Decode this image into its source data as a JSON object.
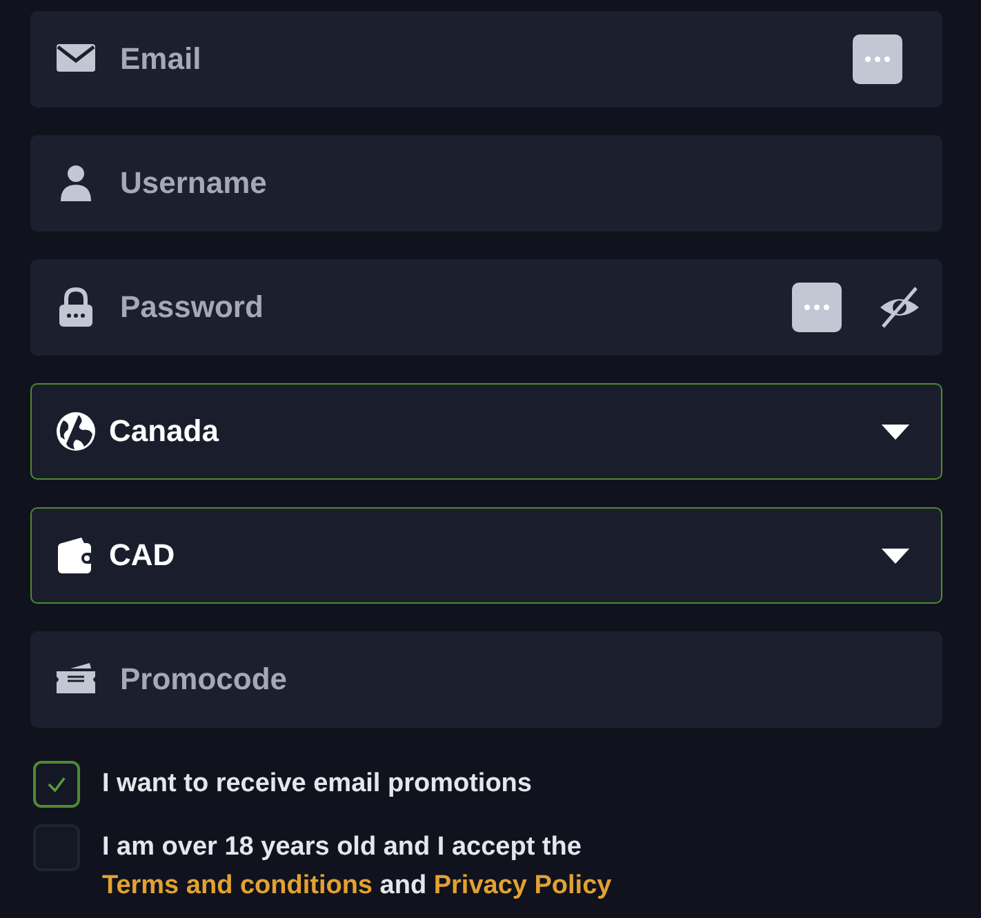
{
  "fields": [
    {
      "kind": "input",
      "placeholder": "Email"
    },
    {
      "kind": "input",
      "placeholder": "Username"
    },
    {
      "kind": "input",
      "placeholder": "Password"
    },
    {
      "kind": "select",
      "value": "Canada"
    },
    {
      "kind": "select",
      "value": "CAD"
    },
    {
      "kind": "input",
      "placeholder": "Promocode"
    }
  ],
  "checkboxes": [
    {
      "checked": true,
      "parts": [
        {
          "kind": "text",
          "text": "I want to receive email promotions"
        }
      ]
    },
    {
      "checked": false,
      "parts": [
        {
          "kind": "text",
          "text": "I am over 18 years old and I accept the "
        },
        {
          "kind": "link",
          "text": "Terms and conditions"
        },
        {
          "kind": "text",
          "text": " and "
        },
        {
          "kind": "link",
          "text": "Privacy Policy"
        }
      ]
    }
  ]
}
